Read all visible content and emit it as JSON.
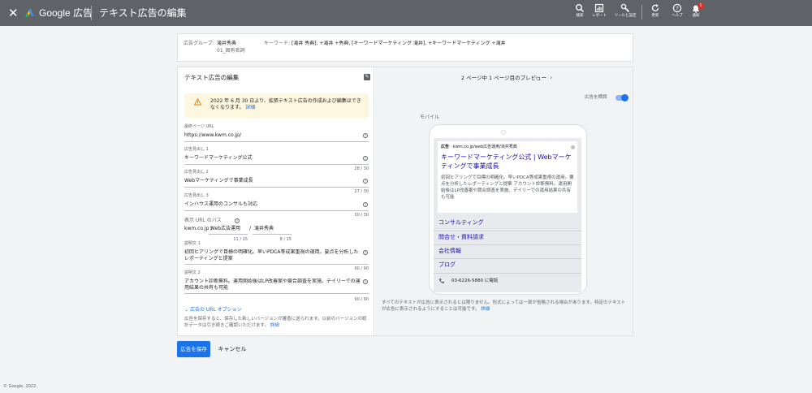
{
  "header": {
    "close_label": "✕",
    "brand": "Google 広告",
    "title": "テキスト広告の編集",
    "tools": [
      {
        "label": "検索",
        "icon": "search-icon"
      },
      {
        "label": "レポート",
        "icon": "report-icon"
      },
      {
        "label": "ツールと設定",
        "icon": "wrench-icon"
      },
      {
        "label": "更新",
        "icon": "refresh-icon"
      },
      {
        "label": "ヘルプ",
        "icon": "help-icon"
      },
      {
        "label": "通知",
        "icon": "bell-icon",
        "badge": "1"
      }
    ]
  },
  "info": {
    "adgroup_label": "広告グループ:",
    "adgroup_value": "滝井秀典",
    "adgroup_sub": "01_固有名詞",
    "keyword_label": "キーワード:",
    "keyword_value": "[滝井 秀典], +滝井 +秀典, [キーワードマーケティング 滝井], +キーワードマーケティング +滝井"
  },
  "editor": {
    "title": "テキスト広告の編集",
    "warning": "2022 年 6 月 30 日より、拡張テキスト広告の作成および編集はできなくなります。",
    "warning_link": "詳細",
    "final_url_label": "最終ページ URL",
    "final_url": "https://www.kwm.co.jp/",
    "headline1_label": "広告見出し 1",
    "headline1": "キーワードマーケティング公式",
    "headline1_count": "28 / 30",
    "headline2_label": "広告見出し 2",
    "headline2": "Webマーケティングで事業成長",
    "headline2_count": "27 / 30",
    "headline3_label": "広告見出し 3",
    "headline3": "インハウス運用のコンサルも対応",
    "headline3_count": "30 / 30",
    "display_path_label": "表示 URL のパス",
    "display_domain": "kwm.co.jp /",
    "path1": "Web広告運用",
    "path_sep": "/",
    "path2": "滝井秀典",
    "path1_count": "11 / 15",
    "path2_count": "8 / 15",
    "desc1_label": "説明文 1",
    "desc1": "初回ヒアリングで目標の明確化。早いPDCA等成果重視の運用。要点を分析したレポーティングと提案",
    "desc1_count": "90 / 90",
    "desc2_label": "説明文 2",
    "desc2": "アカウント診断無料。運用開始後はLP改善案や競合調査を実施。デイリーでの運用結果の共有も可能",
    "desc2_count": "90 / 90",
    "url_options": "広告の URL オプション",
    "save_note": "広告を保存すると、保存した新しいバージョンが審査に送られます。以前のバージョンの統計データは引き続きご確認いただけます。",
    "save_note_link": "詳細"
  },
  "preview": {
    "header": "2 ページ中 1 ページ目のプレビュー",
    "prev": "‹",
    "next": "›",
    "toggle_label": "広告を横調",
    "device_label": "モバイル",
    "ad_badge": "広告",
    "ad_url": "kwm.co.jp/web広告運用/滝井秀典",
    "ad_title": "キーワードマーケティング公式 | Webマーケティングで事業成長",
    "ad_desc": "初回ヒアリングで目標の明確化。早いPDCA等成果重視の運用。要点を分析したレポーティングと提案 アカウント診断無料。運用開始後はLP改善案や競合調査を実施。デイリーでの運用結果の共有も可能",
    "sitelinks": [
      "コンサルティング",
      "問合せ・資料請求",
      "会社情報",
      "ブログ"
    ],
    "call": "03-6226-5880 に電話",
    "disclaimer": "すべてのテキストが広告に表示されるとは限りません。形式によっては一部が省略される場合があります。特定のテキストが広告に表示されるようにすることは可能です。",
    "disclaimer_link": "詳細"
  },
  "actions": {
    "save": "広告を保存",
    "cancel": "キャンセル"
  },
  "footer": {
    "copyright": "© Google, 2022."
  }
}
